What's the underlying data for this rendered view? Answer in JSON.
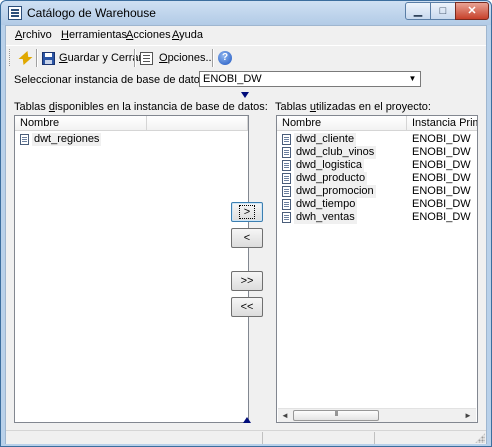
{
  "window": {
    "title": "Catálogo de Warehouse",
    "min_glyph": "▁",
    "max_glyph": "□",
    "close_glyph": "✕"
  },
  "menu": {
    "items": [
      {
        "accel": "A",
        "rest": "rchivo"
      },
      {
        "accel": "H",
        "rest": "erramientas"
      },
      {
        "accel": "A",
        "rest": "cciones"
      },
      {
        "accel": "A",
        "rest": "yuda"
      }
    ]
  },
  "toolbar": {
    "save": {
      "accel": "G",
      "rest": "uardar y Cerrar"
    },
    "options": {
      "accel": "O",
      "rest": "pciones..."
    },
    "help_glyph": "?"
  },
  "instance": {
    "label": "Seleccionar instancia de base de datos actual",
    "selected": "ENOBI_DW",
    "dropdown_glyph": "▼"
  },
  "available": {
    "label_before": "Tablas ",
    "label_accel": "d",
    "label_after": "isponibles en la instancia de base de datos:",
    "columns": [
      "Nombre",
      ""
    ],
    "rows": [
      {
        "name": "dwt_regiones"
      }
    ]
  },
  "project": {
    "label_before": "Tablas ",
    "label_accel": "u",
    "label_after": "tilizadas en el proyecto:",
    "columns": [
      "Nombre",
      "Instancia Prima"
    ],
    "rows": [
      {
        "name": "dwd_cliente",
        "instance": "ENOBI_DW"
      },
      {
        "name": "dwd_club_vinos",
        "instance": "ENOBI_DW"
      },
      {
        "name": "dwd_logistica",
        "instance": "ENOBI_DW"
      },
      {
        "name": "dwd_producto",
        "instance": "ENOBI_DW"
      },
      {
        "name": "dwd_promocion",
        "instance": "ENOBI_DW"
      },
      {
        "name": "dwd_tiempo",
        "instance": "ENOBI_DW"
      },
      {
        "name": "dwh_ventas",
        "instance": "ENOBI_DW"
      }
    ],
    "scroll_left": "◄",
    "scroll_right": "►",
    "thumb_grip": "III"
  },
  "move_buttons": {
    "add": ">",
    "remove": "<",
    "add_all": ">>",
    "remove_all": "<<"
  },
  "colors": {
    "title_bar": "#b9d1ea",
    "arrow_blue": "#000c7a",
    "close_red": "#c7402a"
  }
}
